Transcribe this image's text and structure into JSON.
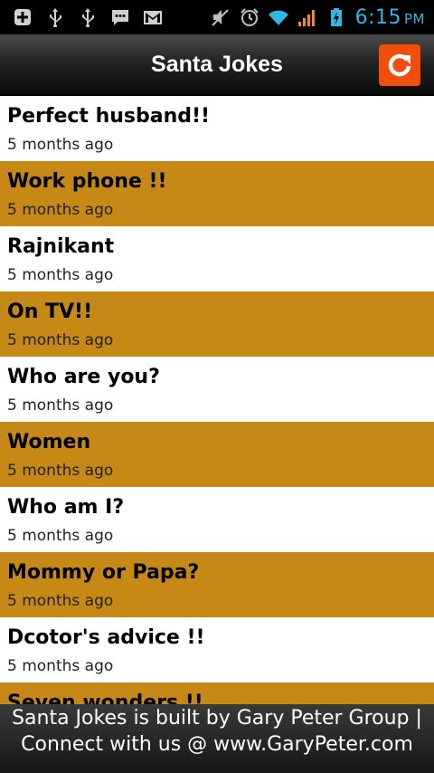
{
  "status_bar": {
    "left_icons": [
      "add-notification-icon",
      "usb-icon",
      "usb-icon",
      "message-icon",
      "gmail-icon"
    ],
    "right_icons": [
      "mute-icon",
      "alarm-icon",
      "wifi-icon",
      "signal-icon",
      "battery-charging-icon"
    ],
    "time": "6:15",
    "ampm": "PM",
    "time_color": "#33b5e5"
  },
  "app_bar": {
    "title": "Santa Jokes",
    "refresh_icon": "refresh-icon",
    "refresh_color": "#f04e0a"
  },
  "list": {
    "alt_color": "#c68915",
    "items": [
      {
        "title": "Perfect husband!!",
        "time": "5 months ago"
      },
      {
        "title": "Work phone !!",
        "time": "5 months ago"
      },
      {
        "title": "Rajnikant",
        "time": "5 months ago"
      },
      {
        "title": "On TV!!",
        "time": "5 months ago"
      },
      {
        "title": "Who are you?",
        "time": "5 months ago"
      },
      {
        "title": "Women",
        "time": "5 months ago"
      },
      {
        "title": "Who am I?",
        "time": "5 months ago"
      },
      {
        "title": "Mommy or Papa?",
        "time": "5 months ago"
      },
      {
        "title": "Dcotor's advice !!",
        "time": "5 months ago"
      },
      {
        "title": "Seven wonders !!",
        "time": ""
      }
    ]
  },
  "footer": {
    "line1": "Santa Jokes is built by Gary Peter Group |",
    "line2": "Connect with us @ www.GaryPeter.com"
  }
}
